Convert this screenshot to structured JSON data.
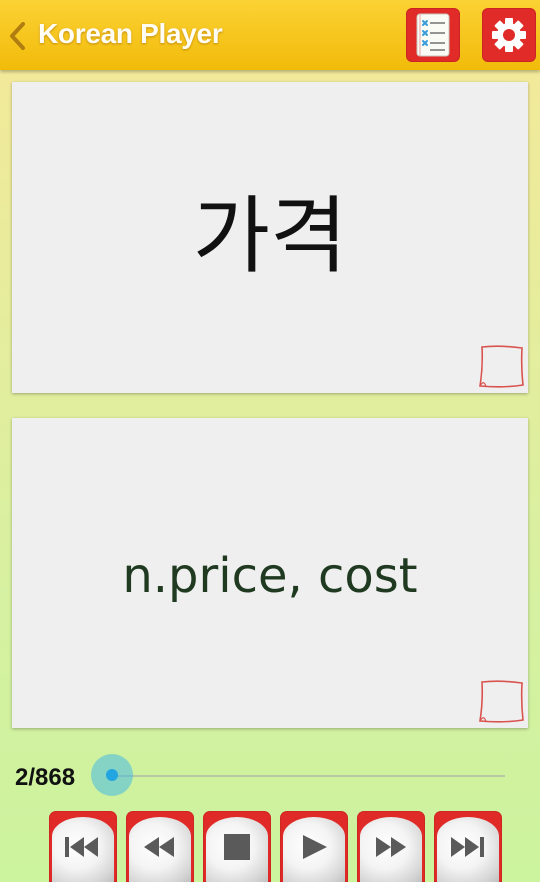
{
  "header": {
    "title": "Korean Player",
    "back_icon": "chevron-left-icon",
    "list_icon": "checklist-icon",
    "settings_icon": "gear-icon"
  },
  "card_front": {
    "word": "가격",
    "note_icon": "sticky-note-icon"
  },
  "card_back": {
    "meaning": "n.price, cost",
    "note_icon": "sticky-note-icon"
  },
  "progress": {
    "counter": "2/868",
    "current": 2,
    "total": 868
  },
  "controls": [
    {
      "name": "first",
      "icon": "skip-first-icon"
    },
    {
      "name": "previous",
      "icon": "rewind-icon"
    },
    {
      "name": "stop",
      "icon": "stop-icon"
    },
    {
      "name": "play",
      "icon": "play-icon"
    },
    {
      "name": "next",
      "icon": "fast-forward-icon"
    },
    {
      "name": "last",
      "icon": "skip-last-icon"
    }
  ],
  "colors": {
    "header": "#f5c51c",
    "button_red": "#df2a27",
    "slider_accent": "#33b5e5",
    "meaning_text": "#1f3a20"
  }
}
